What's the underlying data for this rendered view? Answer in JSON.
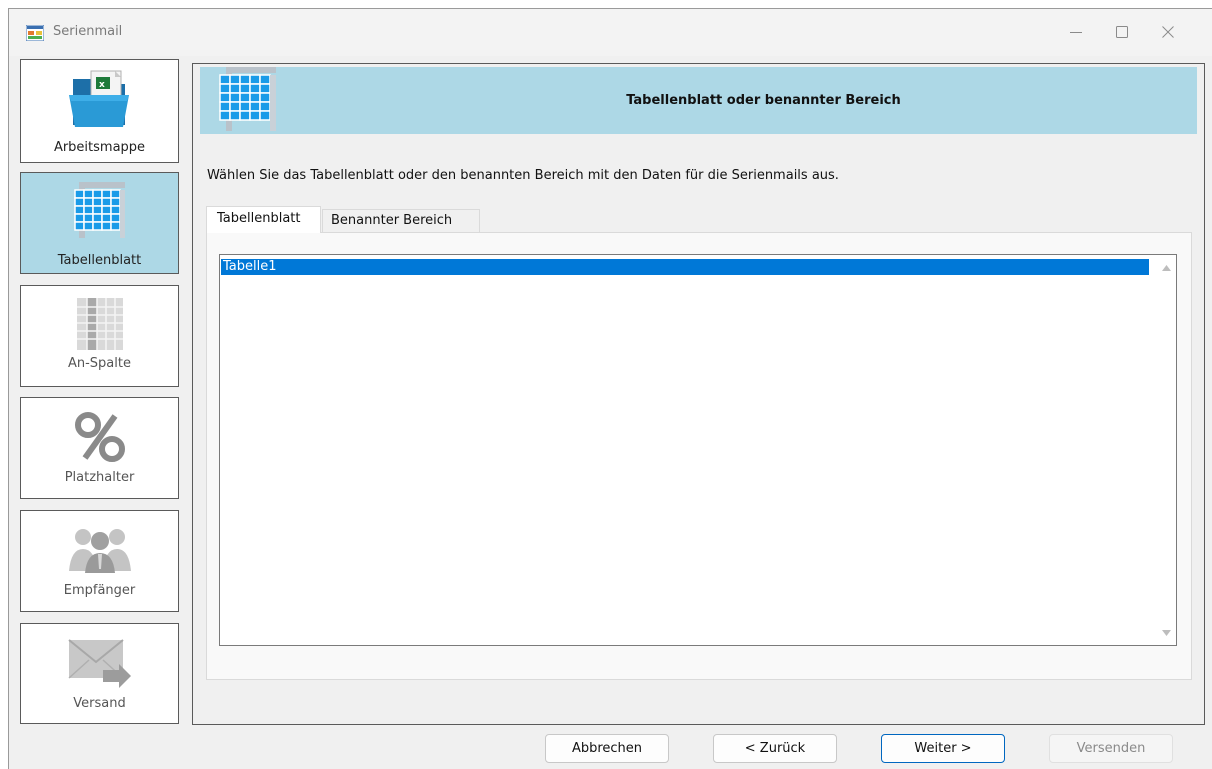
{
  "window": {
    "title": "Serienmail",
    "controls": [
      "minimize-icon",
      "maximize-icon",
      "close-icon"
    ]
  },
  "sidebar": {
    "items": [
      {
        "label": "Arbeitsmappe",
        "icon": "workbook-folder-icon",
        "state": "done"
      },
      {
        "label": "Tabellenblatt",
        "icon": "worksheet-grid-icon",
        "state": "active"
      },
      {
        "label": "An-Spalte",
        "icon": "column-grid-icon",
        "state": "disabled"
      },
      {
        "label": "Platzhalter",
        "icon": "percent-icon",
        "state": "disabled"
      },
      {
        "label": "Empfänger",
        "icon": "people-icon",
        "state": "disabled"
      },
      {
        "label": "Versand",
        "icon": "send-mail-icon",
        "state": "disabled"
      }
    ]
  },
  "main": {
    "banner_title": "Tabellenblatt oder benannter Bereich",
    "instruction": "Wählen Sie das Tabellenblatt oder den benannten Bereich mit den Daten für die Serienmails aus.",
    "tabs": [
      {
        "label": "Tabellenblatt",
        "selected": true
      },
      {
        "label": "Benannter Bereich",
        "selected": false
      }
    ],
    "list": {
      "items": [
        "Tabelle1"
      ],
      "selected": "Tabelle1"
    }
  },
  "buttons": {
    "cancel": "Abbrechen",
    "back": "< Zurück",
    "next": "Weiter >",
    "send": "Versenden"
  },
  "colors": {
    "accent": "#add8e6",
    "selection": "#0078d7",
    "default_button_border": "#0067c0"
  }
}
